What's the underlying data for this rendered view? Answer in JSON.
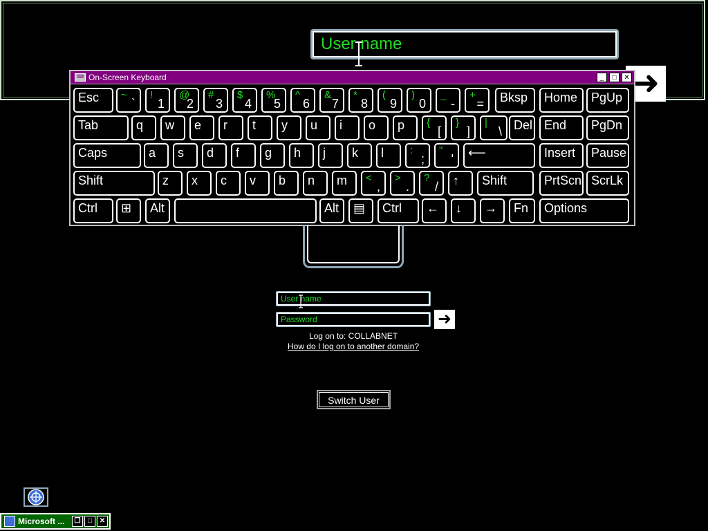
{
  "magnifier": {
    "username_text": "User name"
  },
  "osk": {
    "title": "On-Screen Keyboard",
    "controls": {
      "minimize": "_",
      "maximize": "□",
      "close": "✕"
    },
    "rows": [
      [
        {
          "id": "esc",
          "main": "Esc"
        },
        {
          "id": "backtick",
          "shift": "~",
          "base": "`"
        },
        {
          "id": "1",
          "shift": "!",
          "base": "1"
        },
        {
          "id": "2",
          "shift": "@",
          "base": "2"
        },
        {
          "id": "3",
          "shift": "#",
          "base": "3"
        },
        {
          "id": "4",
          "shift": "$",
          "base": "4"
        },
        {
          "id": "5",
          "shift": "%",
          "base": "5"
        },
        {
          "id": "6",
          "shift": "^",
          "base": "6"
        },
        {
          "id": "7",
          "shift": "&",
          "base": "7"
        },
        {
          "id": "8",
          "shift": "*",
          "base": "8"
        },
        {
          "id": "9",
          "shift": "(",
          "base": "9"
        },
        {
          "id": "0",
          "shift": ")",
          "base": "0"
        },
        {
          "id": "minus",
          "shift": "_",
          "base": "-"
        },
        {
          "id": "equals",
          "shift": "+",
          "base": "="
        },
        {
          "id": "bksp",
          "main": "Bksp"
        },
        {
          "id": "home",
          "main": "Home"
        },
        {
          "id": "pgup",
          "main": "PgUp"
        }
      ],
      [
        {
          "id": "tab",
          "main": "Tab"
        },
        {
          "id": "q",
          "main": "q"
        },
        {
          "id": "w",
          "main": "w"
        },
        {
          "id": "e",
          "main": "e"
        },
        {
          "id": "r",
          "main": "r"
        },
        {
          "id": "t",
          "main": "t"
        },
        {
          "id": "y",
          "main": "y"
        },
        {
          "id": "u",
          "main": "u"
        },
        {
          "id": "i",
          "main": "i"
        },
        {
          "id": "o",
          "main": "o"
        },
        {
          "id": "p",
          "main": "p"
        },
        {
          "id": "lbracket",
          "shift": "{",
          "base": "["
        },
        {
          "id": "rbracket",
          "shift": "}",
          "base": "]"
        },
        {
          "id": "backslash",
          "shift": "|",
          "base": "\\"
        },
        {
          "id": "del",
          "main": "Del"
        },
        {
          "id": "end",
          "main": "End"
        },
        {
          "id": "pgdn",
          "main": "PgDn"
        }
      ],
      [
        {
          "id": "caps",
          "main": "Caps"
        },
        {
          "id": "a",
          "main": "a"
        },
        {
          "id": "s",
          "main": "s"
        },
        {
          "id": "d",
          "main": "d"
        },
        {
          "id": "f",
          "main": "f"
        },
        {
          "id": "g",
          "main": "g"
        },
        {
          "id": "h",
          "main": "h"
        },
        {
          "id": "j",
          "main": "j"
        },
        {
          "id": "k",
          "main": "k"
        },
        {
          "id": "l",
          "main": "l"
        },
        {
          "id": "semicolon",
          "shift": ":",
          "base": ";"
        },
        {
          "id": "quote",
          "shift": "\"",
          "base": "'"
        },
        {
          "id": "enter",
          "main": "⟵"
        },
        {
          "id": "insert",
          "main": "Insert"
        },
        {
          "id": "pause",
          "main": "Pause"
        }
      ],
      [
        {
          "id": "lshift",
          "main": "Shift"
        },
        {
          "id": "z",
          "main": "z"
        },
        {
          "id": "x",
          "main": "x"
        },
        {
          "id": "c",
          "main": "c"
        },
        {
          "id": "v",
          "main": "v"
        },
        {
          "id": "b",
          "main": "b"
        },
        {
          "id": "n",
          "main": "n"
        },
        {
          "id": "m",
          "main": "m"
        },
        {
          "id": "comma",
          "shift": "<",
          "base": ","
        },
        {
          "id": "period",
          "shift": ">",
          "base": "."
        },
        {
          "id": "slash",
          "shift": "?",
          "base": "/"
        },
        {
          "id": "up",
          "main": "↑"
        },
        {
          "id": "rshift",
          "main": "Shift"
        },
        {
          "id": "prtscn",
          "main": "PrtScn"
        },
        {
          "id": "scrlk",
          "main": "ScrLk"
        }
      ],
      [
        {
          "id": "lctrl",
          "main": "Ctrl"
        },
        {
          "id": "win",
          "main": "⊞"
        },
        {
          "id": "lalt",
          "main": "Alt"
        },
        {
          "id": "space",
          "main": ""
        },
        {
          "id": "ralt",
          "main": "Alt"
        },
        {
          "id": "menu",
          "main": "▤"
        },
        {
          "id": "rctrl",
          "main": "Ctrl"
        },
        {
          "id": "left",
          "main": "←"
        },
        {
          "id": "down",
          "main": "↓"
        },
        {
          "id": "right",
          "main": "→"
        },
        {
          "id": "fn",
          "main": "Fn"
        },
        {
          "id": "options",
          "main": "Options"
        }
      ]
    ]
  },
  "logon": {
    "username_placeholder": "User name",
    "password_placeholder": "Password",
    "submit_icon": "arrow-right-icon",
    "logon_to": "Log on to: COLLABNET",
    "other_domain_link": "How do I log on to another domain?",
    "switch_user": "Switch User"
  },
  "taskbar": {
    "title": "Microsoft ...",
    "controls": {
      "restore": "❐",
      "maximize": "□",
      "close": "✕"
    }
  },
  "colors": {
    "accent_green": "#22dd22",
    "title_purple": "#800080",
    "taskbar_green": "#006400",
    "field_frame": "#8fa9b8"
  }
}
